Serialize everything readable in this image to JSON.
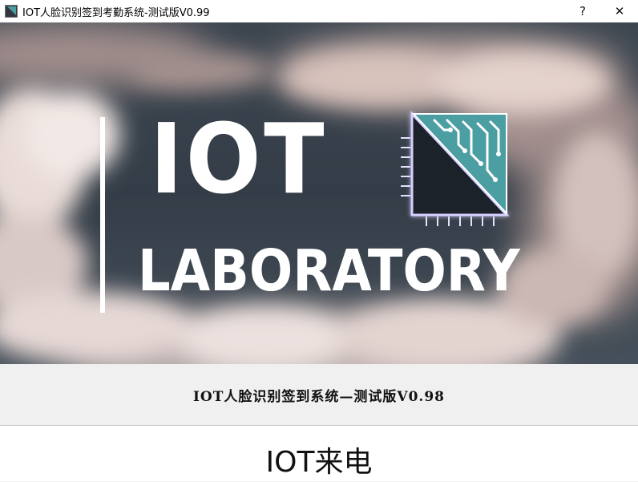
{
  "window": {
    "title": "IOT人脸识别签到考勤系统-测试版V0.99",
    "help_label": "?",
    "close_label": "✕"
  },
  "banner": {
    "logo_line1": "IOT",
    "logo_line2": "LABORATORY",
    "logo_icon": "circuit-chip-icon",
    "colors": {
      "chip_teal": "#4b9ea2",
      "chip_glow": "#cfc6ff"
    }
  },
  "caption": {
    "text": "IOT人脸识别签到系统—测试版V0.98"
  },
  "status": {
    "message": "IOT来电"
  }
}
